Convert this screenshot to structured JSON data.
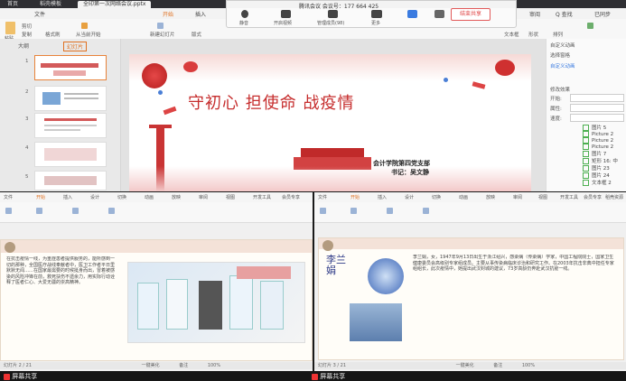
{
  "top": {
    "tabs": [
      {
        "label": "首页"
      },
      {
        "label": "稻壳模板"
      },
      {
        "label": "全印第一次网络会议.pptx"
      }
    ],
    "menu": [
      "文件",
      "开始",
      "插入",
      "设计",
      "切换",
      "动画",
      "放映",
      "审阅",
      "视图",
      "开发工具",
      "会员专享",
      "稻壳资源"
    ],
    "search_label": "Q 查找",
    "share_label": "已同步",
    "meeting": {
      "title": "腾讯会议 会议号：177 664 425",
      "buttons": [
        {
          "label": "静音"
        },
        {
          "label": "开启视频"
        },
        {
          "label": "管理成员(98)"
        },
        {
          "label": "更多"
        },
        {
          "label": "结束共享"
        }
      ],
      "end_label": "结束共享"
    },
    "ribbon": {
      "clipboard": [
        "剪切",
        "复制",
        "格式刷"
      ],
      "paste": "粘贴",
      "from_start": "从当前开始",
      "new_slide": "新建幻灯片",
      "layout": "版式",
      "text_box": "文本框",
      "shape": "形状",
      "arrange": "排列"
    },
    "outline_label": "大纲",
    "slides_label": "幻灯片",
    "thumb_numbers": [
      "1",
      "2",
      "3",
      "4",
      "5"
    ],
    "slide": {
      "title": "守初心  担使命  战疫情",
      "line1": "会计学院第四党支部",
      "line2": "书记：吴文静"
    },
    "right_panel": {
      "header": "自定义动画",
      "select_pane": "选择窗格",
      "custom_anim": "自定义动画",
      "modify_label": "修改效果",
      "start_label": "开始:",
      "property_label": "属性:",
      "speed_label": "速度:",
      "items": [
        {
          "label": "图片 5"
        },
        {
          "label": "Picture 2"
        },
        {
          "label": "Picture 2"
        },
        {
          "label": "Picture 2"
        },
        {
          "label": "图片 7"
        },
        {
          "label": "矩形 16: 中"
        },
        {
          "label": "图片 23"
        },
        {
          "label": "图片 24"
        },
        {
          "label": "文本框 2"
        }
      ]
    }
  },
  "bottom": {
    "left_doc": {
      "menu": [
        "文件",
        "开始",
        "插入",
        "设计",
        "切换",
        "动画",
        "放映",
        "审阅",
        "视图",
        "开发工具",
        "会员专享"
      ],
      "text": "在抗击疫情一线，为重症患者提供服务的，能所感到一切的那种，全国医疗战线奉献者中，医卫工作者平日里默默无闻……在国家最需要的时候挺身而出，冒着被感染的风险冲锋在前，救死扶伤不遗余力，用实际行动诠释了医者仁心、大爱无疆的崇高精神。",
      "status": "幻灯片 2 / 21"
    },
    "right_doc": {
      "menu": [
        "文件",
        "开始",
        "插入",
        "设计",
        "切换",
        "动画",
        "放映",
        "审阅",
        "视图",
        "开发工具",
        "会员专享",
        "稻壳资源"
      ],
      "name_art": "李兰娟",
      "text": "李兰娟，女，1947年9月13日出生于浙江绍兴，感染病（传染病）学家，中国工程院院士，国家卫生健康委员会高级别专家组成员。主要从事传染病临床诊治和研究工作。在2003年抗击非典中担任专家组组长，此次疫情中，她提出武汉封城的建议，73岁高龄仍奔赴武汉抗疫一线。",
      "status": "幻灯片 3 / 21"
    },
    "share_left": "屏幕共享",
    "share_right": "屏幕共享",
    "status_left_items": [
      "一键美化",
      "备注",
      "100%"
    ],
    "status_right_items": [
      "一键美化",
      "备注",
      "100%"
    ]
  }
}
